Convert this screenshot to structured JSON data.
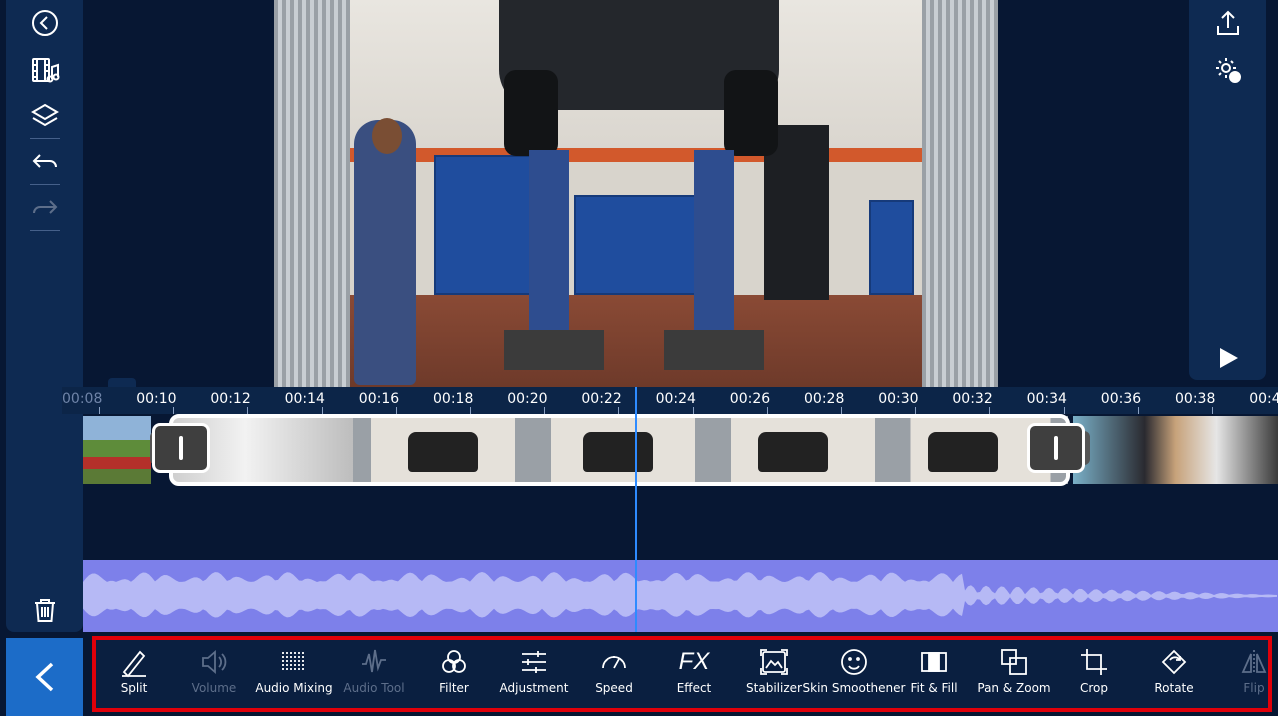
{
  "timeline": {
    "ticks": [
      "00:08",
      "00:10",
      "00:12",
      "00:14",
      "00:16",
      "00:18",
      "00:20",
      "00:22",
      "00:24",
      "00:26",
      "00:28",
      "00:30",
      "00:32",
      "00:34",
      "00:36",
      "00:38",
      "00:4"
    ]
  },
  "toolbar": {
    "tools": [
      {
        "label": "Split",
        "icon": "split-pen-icon",
        "enabled": true
      },
      {
        "label": "Volume",
        "icon": "volume-icon",
        "enabled": false
      },
      {
        "label": "Audio Mixing",
        "icon": "audio-mixing-icon",
        "enabled": true
      },
      {
        "label": "Audio Tool",
        "icon": "audio-tool-icon",
        "enabled": false
      },
      {
        "label": "Filter",
        "icon": "filter-icon",
        "enabled": true
      },
      {
        "label": "Adjustment",
        "icon": "adjustment-sliders-icon",
        "enabled": true
      },
      {
        "label": "Speed",
        "icon": "speed-gauge-icon",
        "enabled": true
      },
      {
        "label": "Effect",
        "icon": "fx-icon",
        "enabled": true
      },
      {
        "label": "Stabilizer",
        "icon": "stabilizer-icon",
        "enabled": true
      },
      {
        "label": "Skin Smoothener",
        "icon": "skin-smoothener-icon",
        "enabled": true
      },
      {
        "label": "Fit & Fill",
        "icon": "fit-fill-icon",
        "enabled": true
      },
      {
        "label": "Pan & Zoom",
        "icon": "pan-zoom-icon",
        "enabled": true
      },
      {
        "label": "Crop",
        "icon": "crop-icon",
        "enabled": true
      },
      {
        "label": "Rotate",
        "icon": "rotate-icon",
        "enabled": true
      },
      {
        "label": "Flip",
        "icon": "flip-icon",
        "enabled": false
      }
    ],
    "fx_glyph": "FX"
  },
  "colors": {
    "accent": "#1c6cc8",
    "highlight": "#e0000a",
    "audio_track": "#7d80ea",
    "playhead": "#2e8bff"
  }
}
